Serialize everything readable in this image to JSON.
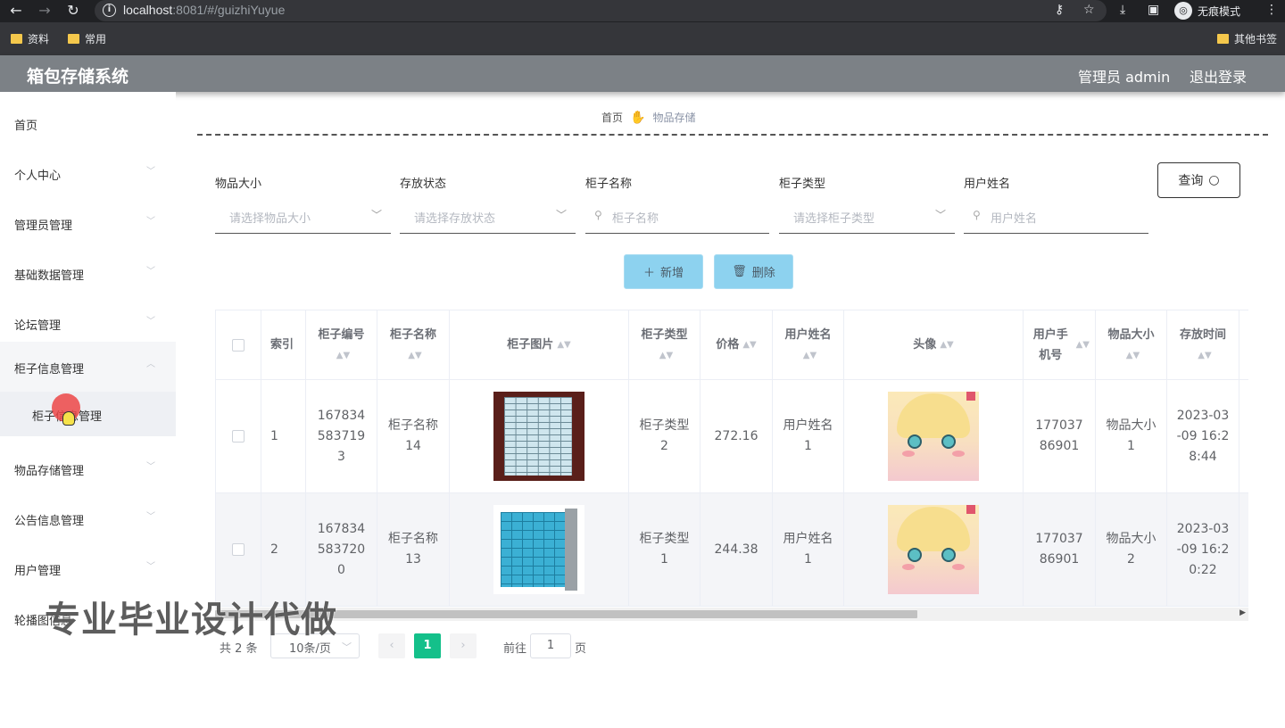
{
  "browser": {
    "url_host": "localhost",
    "url_rest": ":8081/#/guizhiYuyue",
    "incognito_label": "无痕模式",
    "bookmarks": [
      "资料",
      "常用"
    ],
    "other_bookmarks": "其他书签"
  },
  "header": {
    "title": "箱包存储系统",
    "admin": "管理员 admin",
    "logout": "退出登录"
  },
  "sidebar": {
    "items": [
      {
        "label": "首页"
      },
      {
        "label": "个人中心"
      },
      {
        "label": "管理员管理"
      },
      {
        "label": "基础数据管理"
      },
      {
        "label": "论坛管理"
      },
      {
        "label": "柜子信息管理"
      },
      {
        "label": "物品存储管理"
      },
      {
        "label": "公告信息管理"
      },
      {
        "label": "用户管理"
      },
      {
        "label": "轮播图信息"
      }
    ],
    "sub_item": "柜子信息管理"
  },
  "breadcrumb": {
    "home": "首页",
    "current": "物品存储"
  },
  "search": {
    "fields": [
      {
        "label": "物品大小",
        "placeholder": "请选择物品大小",
        "type": "select"
      },
      {
        "label": "存放状态",
        "placeholder": "请选择存放状态",
        "type": "select"
      },
      {
        "label": "柜子名称",
        "placeholder": "柜子名称",
        "type": "input"
      },
      {
        "label": "柜子类型",
        "placeholder": "请选择柜子类型",
        "type": "select"
      },
      {
        "label": "用户姓名",
        "placeholder": "用户姓名",
        "type": "input"
      }
    ],
    "query_button": "查询"
  },
  "actions": {
    "add": "新增",
    "delete": "删除"
  },
  "table": {
    "columns": [
      "索引",
      "柜子编号",
      "柜子名称",
      "柜子图片",
      "柜子类型",
      "价格",
      "用户姓名",
      "头像",
      "用户手机号",
      "物品大小",
      "存放时间"
    ],
    "rows": [
      {
        "index": "1",
        "code": "1678345837193",
        "name": "柜子名称14",
        "type": "柜子类型2",
        "price": "272.16",
        "user": "用户姓名1",
        "phone": "17703786901",
        "size": "物品大小1",
        "time": "2023-03-09 16:28:44"
      },
      {
        "index": "2",
        "code": "1678345837200",
        "name": "柜子名称13",
        "type": "柜子类型1",
        "price": "244.38",
        "user": "用户姓名1",
        "phone": "17703786901",
        "size": "物品大小2",
        "time": "2023-03-09 16:20:22"
      }
    ]
  },
  "pagination": {
    "total": "共 2 条",
    "page_size": "10条/页",
    "current_page": "1",
    "goto_label": "前往",
    "goto_value": "1",
    "page_suffix": "页"
  },
  "watermark": "专业毕业设计代做",
  "colors": {
    "header_bg": "#7c8186",
    "action_btn": "#8dd2ef",
    "active_page": "#14c08a"
  }
}
